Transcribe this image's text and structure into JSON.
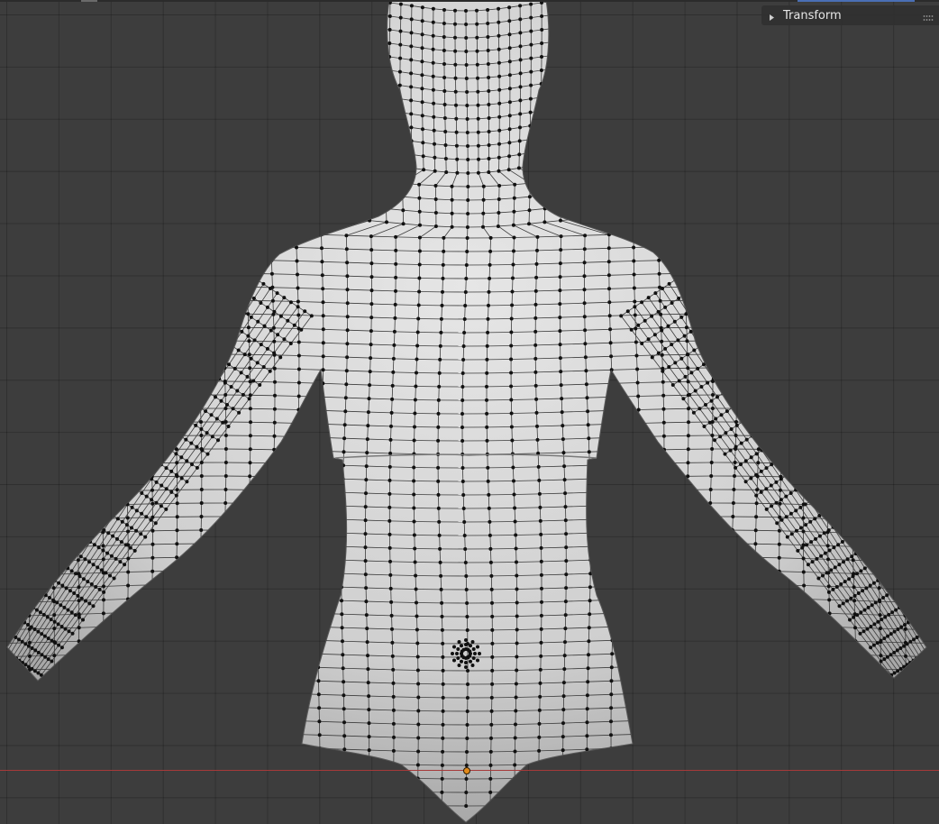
{
  "viewport": {
    "grid_color": "#2f2f2f",
    "background_color": "#3d3d3d",
    "x_axis_color": "#a63a3a",
    "origin_color": "#e28a1a",
    "mesh_fill": "#d4d4d4",
    "vertex_color": "#000000"
  },
  "sidebar": {
    "transform_panel": {
      "label": "Transform",
      "collapsed_icon": "triangle-right-icon",
      "handle_icon": "drag-handle-icon"
    }
  }
}
